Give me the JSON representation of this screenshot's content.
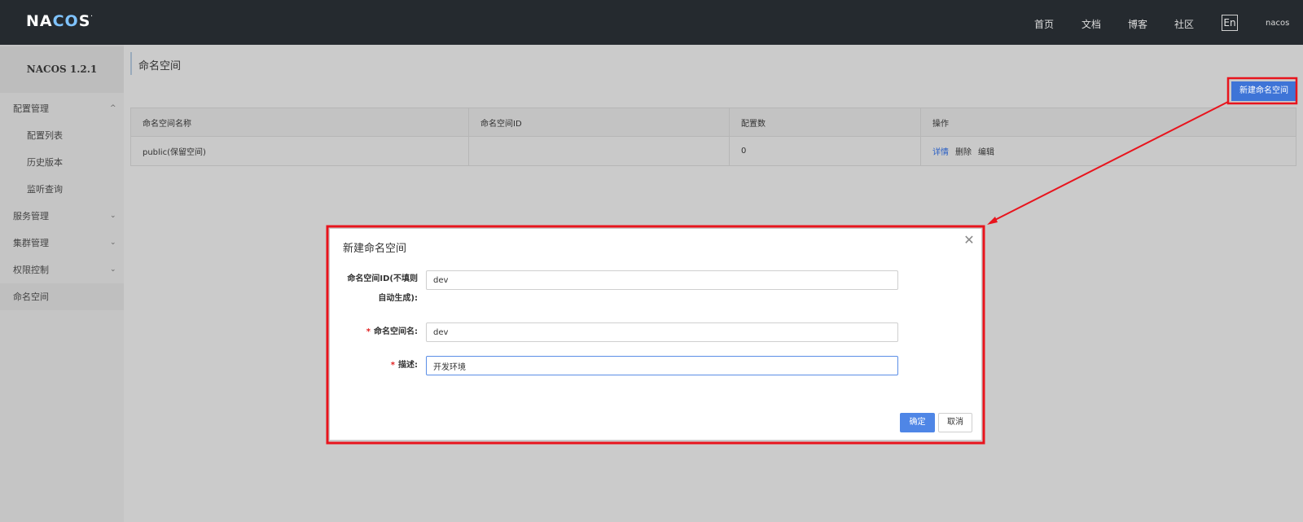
{
  "header": {
    "logo": {
      "pre": "NA",
      "accent": "CO",
      "post": "S",
      "mark": "."
    },
    "nav": [
      {
        "label": "首页"
      },
      {
        "label": "文档"
      },
      {
        "label": "博客"
      },
      {
        "label": "社区"
      }
    ],
    "lang": "En",
    "user": "nacos"
  },
  "sidebar": {
    "version": "NACOS 1.2.1",
    "items": [
      {
        "label": "配置管理",
        "expanded": true
      },
      {
        "label": "配置列表"
      },
      {
        "label": "历史版本"
      },
      {
        "label": "监听查询"
      },
      {
        "label": "服务管理",
        "expanded": false
      },
      {
        "label": "集群管理",
        "expanded": false
      },
      {
        "label": "权限控制",
        "expanded": false
      },
      {
        "label": "命名空间",
        "active": true
      }
    ]
  },
  "main": {
    "title": "命名空间",
    "create_button": "新建命名空间",
    "table": {
      "headers": [
        "命名空间名称",
        "命名空间ID",
        "配置数",
        "操作"
      ],
      "rows": [
        {
          "name": "public(保留空间)",
          "id": "",
          "count": "0",
          "actions": [
            "详情",
            "删除",
            "编辑"
          ]
        }
      ]
    }
  },
  "dialog": {
    "title": "新建命名空间",
    "fields": {
      "id_label_line1": "命名空间ID(不填则",
      "id_label_line2": "自动生成):",
      "id_value": "dev",
      "name_label": "命名空间名:",
      "name_value": "dev",
      "desc_label": "描述:",
      "desc_value": "开发环境",
      "required_mark": "*"
    },
    "ok": "确定",
    "cancel": "取消"
  },
  "colors": {
    "topbar": "#252a2f",
    "primary": "#3e74d7",
    "annotation": "#e8141d"
  }
}
